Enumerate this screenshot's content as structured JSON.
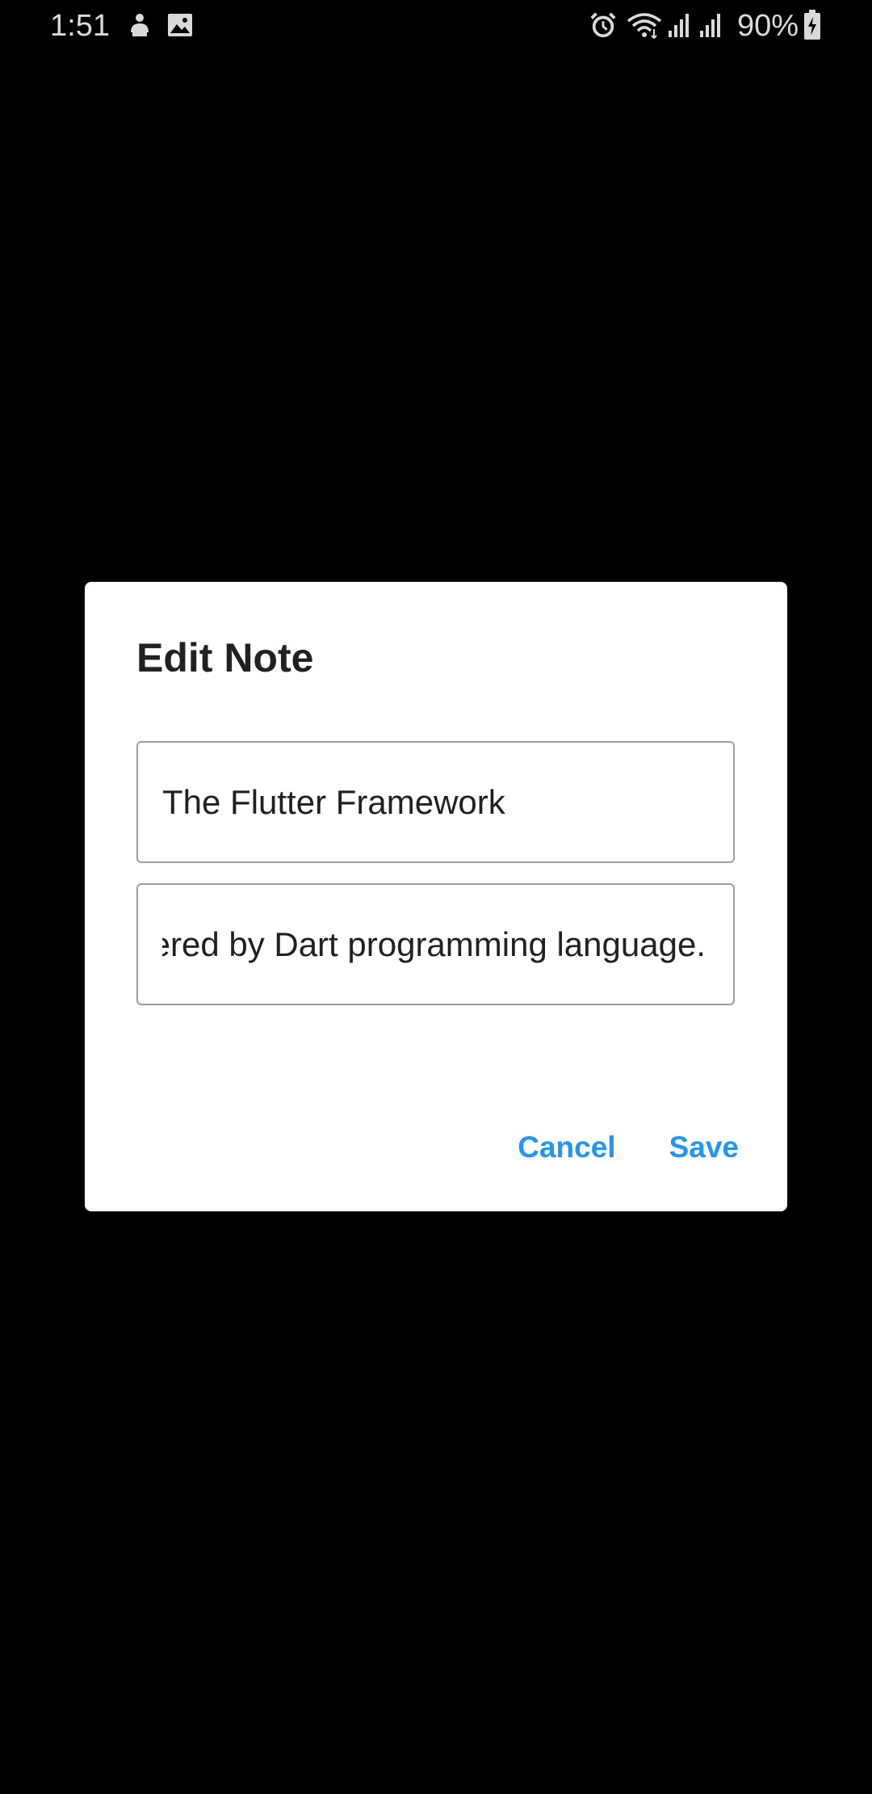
{
  "status_bar": {
    "time": "1:51",
    "battery_percent": "90%",
    "icons_left": [
      "usb-debug-icon",
      "image-icon"
    ],
    "icons_right": [
      "alarm-icon",
      "wifi-icon",
      "signal-icon",
      "signal-icon",
      "battery-charging-icon"
    ]
  },
  "dialog": {
    "title": "Edit Note",
    "title_field": {
      "value": "The Flutter Framework"
    },
    "body_field": {
      "value": "ered by Dart programming language."
    },
    "actions": {
      "cancel_label": "Cancel",
      "save_label": "Save"
    },
    "accent_color": "#2196f3"
  }
}
